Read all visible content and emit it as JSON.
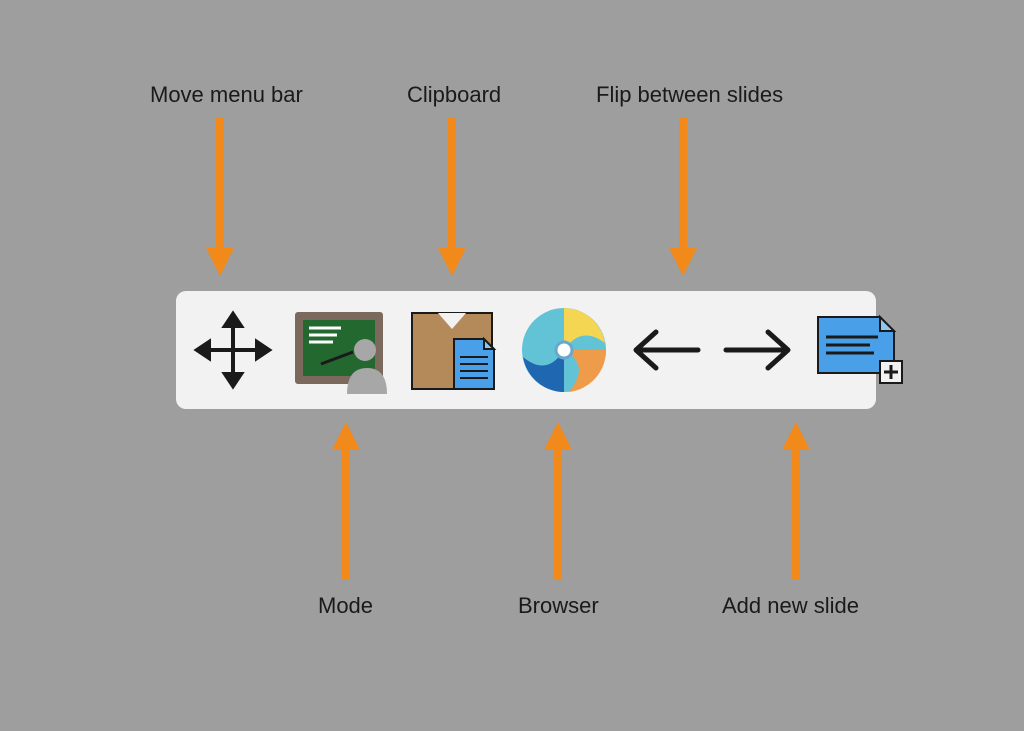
{
  "labels": {
    "move": "Move menu bar",
    "clipboard": "Clipboard",
    "flip": "Flip between slides",
    "mode": "Mode",
    "browser": "Browser",
    "add": "Add new slide"
  },
  "colors": {
    "arrow": "#f18a1a",
    "toolbar": "#f2f2f2",
    "text": "#1a1a1a"
  },
  "icons": [
    "move-handle-icon",
    "mode-chalkboard-icon",
    "clipboard-icon",
    "browser-swirl-icon",
    "arrow-left-icon",
    "arrow-right-icon",
    "add-slide-icon"
  ]
}
